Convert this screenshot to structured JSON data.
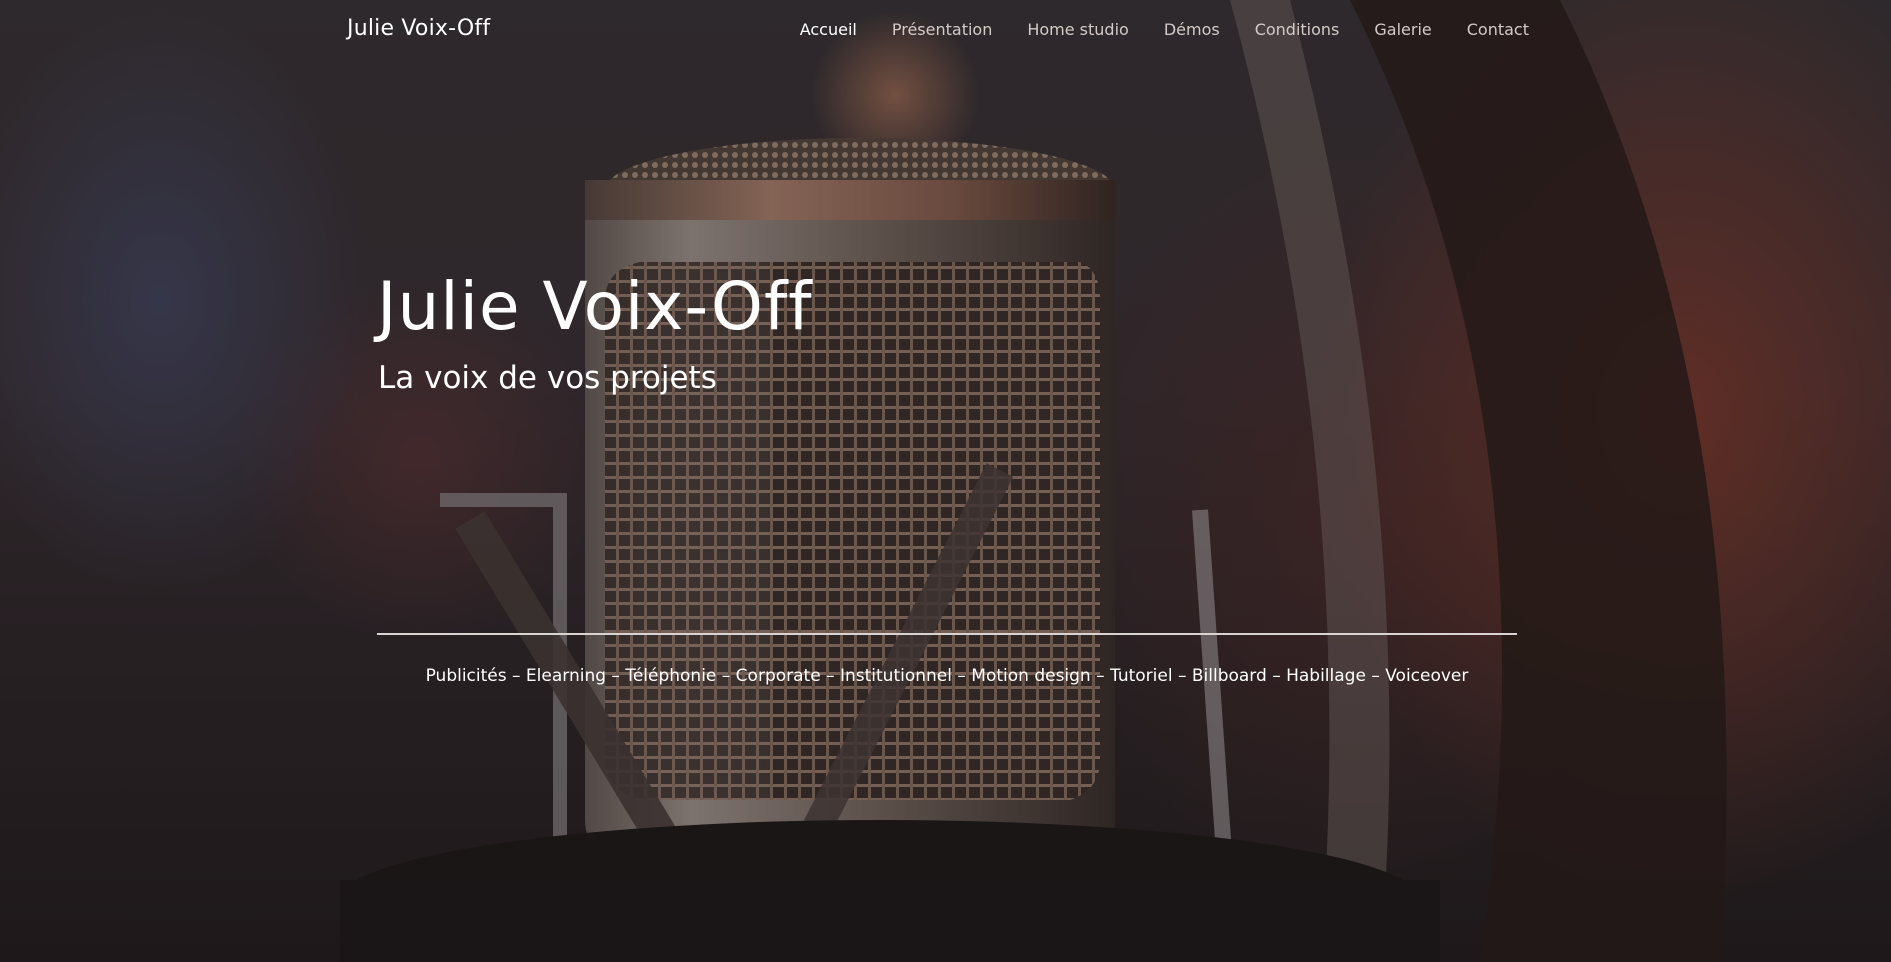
{
  "header": {
    "brand": "Julie Voix-Off",
    "nav": [
      {
        "label": "Accueil",
        "active": true
      },
      {
        "label": "Présentation",
        "active": false
      },
      {
        "label": "Home studio",
        "active": false
      },
      {
        "label": "Démos",
        "active": false
      },
      {
        "label": "Conditions",
        "active": false
      },
      {
        "label": "Galerie",
        "active": false
      },
      {
        "label": "Contact",
        "active": false
      }
    ]
  },
  "hero": {
    "title": "Julie Voix-Off",
    "subtitle": "La voix de vos projets",
    "services": "Publicités – Elearning – Téléphonie – Corporate – Institutionnel – Motion design – Tutoriel – Billboard – Habillage – Voiceover"
  },
  "background": {
    "image": "microphone-photo",
    "colors": {
      "base": "#241f21",
      "accent_warm": "#963e2d",
      "accent_cool": "#484e70"
    }
  }
}
